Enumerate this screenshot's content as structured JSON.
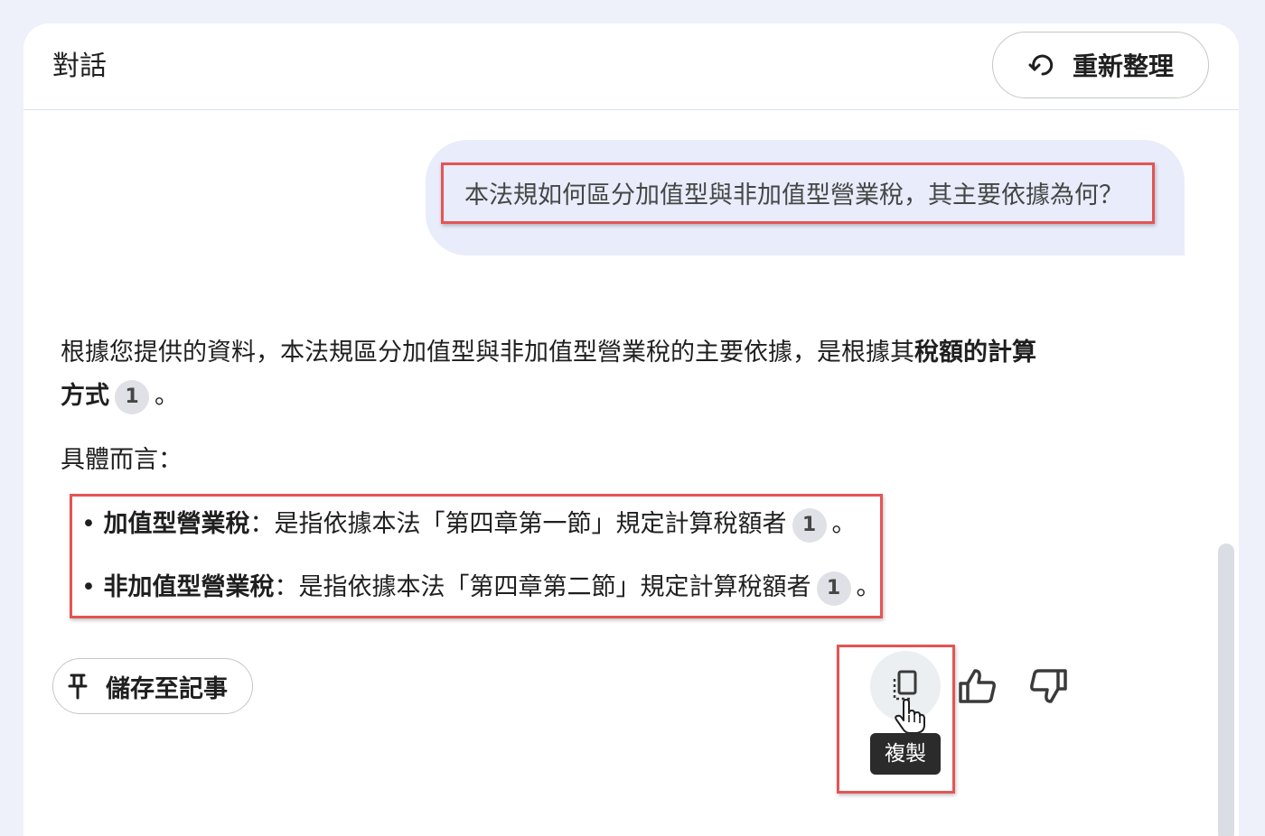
{
  "header": {
    "title": "對話",
    "refresh_label": "重新整理"
  },
  "user_message": "本法規如何區分加值型與非加值型營業稅，其主要依據為何？",
  "answer": {
    "intro_part1": "根據您提供的資料，本法規區分加值型與非加值型營業稅的主要依據，是根據其",
    "intro_bold1": "稅額的計算",
    "intro_bold2": "方式",
    "intro_citation": "1",
    "intro_end": "。",
    "specific_label": "具體而言：",
    "bullets": [
      {
        "term": "加值型營業稅",
        "desc": "：是指依據本法「第四章第一節」規定計算稅額者",
        "citation": "1",
        "end": "。"
      },
      {
        "term": "非加值型營業稅",
        "desc": "：是指依據本法「第四章第二節」規定計算稅額者",
        "citation": "1",
        "end": "。"
      }
    ]
  },
  "actions": {
    "save_label": "儲存至記事",
    "copy_tooltip": "複製",
    "icons": [
      "pin-icon",
      "copy-icon",
      "thumbs-up-icon",
      "thumbs-down-icon",
      "refresh-icon",
      "hand-cursor-icon"
    ]
  },
  "colors": {
    "highlight_border": "#e35555",
    "user_bubble": "#e9ecfa",
    "background": "#eef1fa"
  }
}
